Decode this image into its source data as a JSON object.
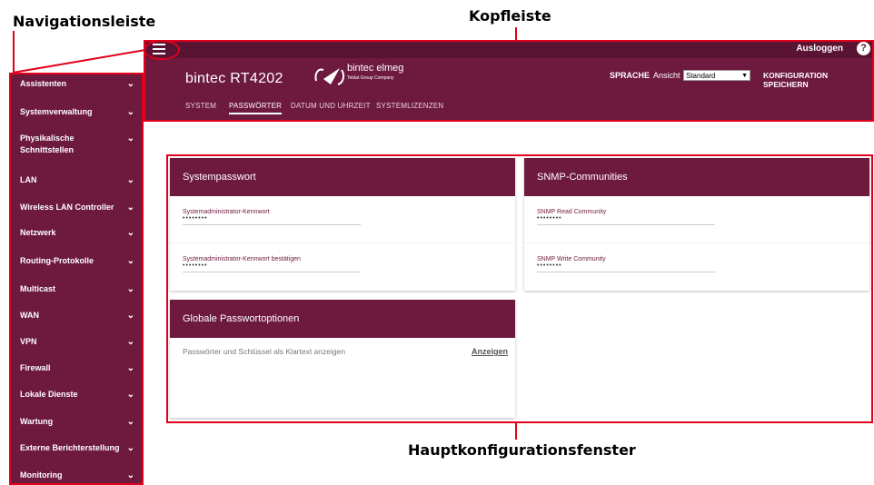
{
  "callouts": {
    "nav": "Navigationsleiste",
    "header": "Kopfleiste",
    "main": "Hauptkonfigurationsfenster"
  },
  "topbar": {
    "logout": "Ausloggen",
    "help": "?"
  },
  "header": {
    "device_name": "bintec RT4202",
    "logo_name": "bintec elmeg",
    "logo_sub": "Teldat Group Company",
    "language": "SPRACHE",
    "view_label": "Ansicht",
    "view_value": "Standard",
    "save": "KONFIGURATION SPEICHERN"
  },
  "tabs": [
    "SYSTEM",
    "PASSWÖRTER",
    "DATUM UND UHRZEIT",
    "SYSTEMLIZENZEN"
  ],
  "nav": [
    "Assistenten",
    "Systemverwaltung",
    "Physikalische Schnittstellen",
    "LAN",
    "Wireless LAN Controller",
    "Netzwerk",
    "Routing-Protokolle",
    "Multicast",
    "WAN",
    "VPN",
    "Firewall",
    "Lokale Dienste",
    "Wartung",
    "Externe Berichterstellung",
    "Monitoring"
  ],
  "cards": {
    "system_pw": {
      "title": "Systempasswort",
      "f1_label": "Systemadministrator-Kennwort",
      "f1_value": "••••••••",
      "f2_label": "Systemadministrator-Kennwort bestätigen",
      "f2_value": "••••••••"
    },
    "snmp": {
      "title": "SNMP-Communities",
      "f1_label": "SNMP Read Community",
      "f1_value": "••••••••",
      "f2_label": "SNMP Write Community",
      "f2_value": "••••••••"
    },
    "global": {
      "title": "Globale Passwortoptionen",
      "option_label": "Passwörter und Schlüssel als Klartext anzeigen",
      "option_link": "Anzeigen"
    }
  },
  "colors": {
    "accent": "#6e1a3f",
    "callout_red": "#e0001b"
  }
}
